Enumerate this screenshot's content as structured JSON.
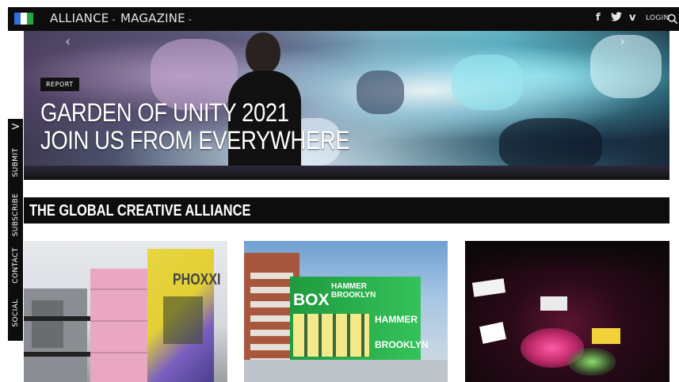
{
  "colors": {
    "topbar": "#0d0d0d",
    "accent_blue": "#2e6fd8",
    "accent_green": "#27a845",
    "text": "#ffffff"
  },
  "topbar": {
    "nav": [
      {
        "label": "ALLIANCE"
      },
      {
        "label": "MAGAZINE"
      }
    ],
    "caret": "-",
    "social": [
      {
        "icon": "facebook-icon",
        "glyph": "f"
      },
      {
        "icon": "twitter-icon",
        "glyph": "🐦"
      },
      {
        "icon": "vimeo-icon",
        "glyph": "v"
      }
    ],
    "login_label": "LOGIN"
  },
  "hero": {
    "tag": "REPORT",
    "title_lines": [
      "GARDEN OF UNITY 2021",
      "JOIN US FROM EVERYWHERE"
    ]
  },
  "sidebar": {
    "toggle": ">",
    "items": [
      {
        "label": "SUBMIT"
      },
      {
        "label": "SUBSCRIBE"
      },
      {
        "label": "CONTACT"
      },
      {
        "label": "SOCIAL"
      }
    ]
  },
  "section": {
    "title": "THE GLOBAL CREATIVE ALLIANCE"
  },
  "cards": [
    {
      "signage": "PHOXXI"
    },
    {
      "signage": [
        "BOX",
        "HAMMER",
        "BROOKLYN",
        "HAMMER",
        "BROOKLYN"
      ]
    },
    {
      "signage": ""
    }
  ]
}
